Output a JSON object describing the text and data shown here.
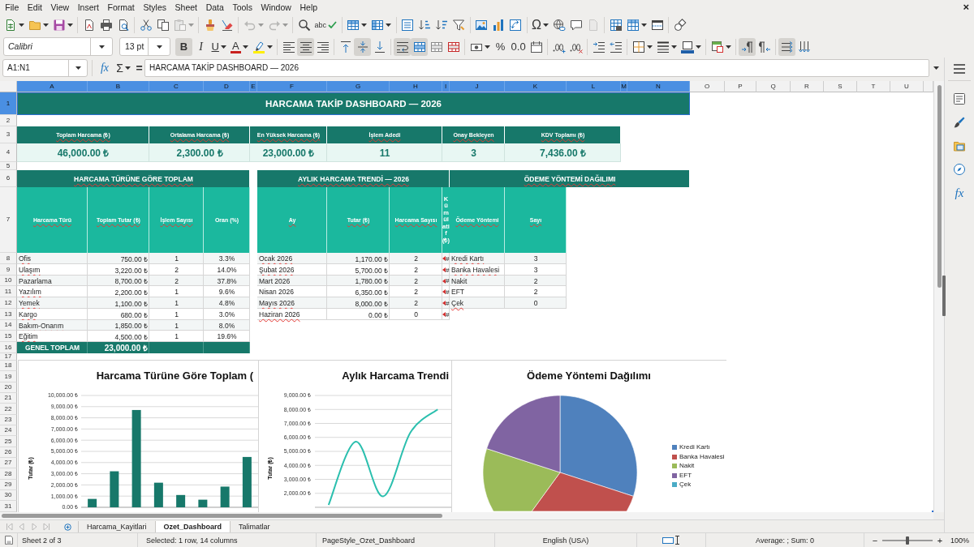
{
  "menu_bar": {
    "items": [
      "File",
      "Edit",
      "View",
      "Insert",
      "Format",
      "Styles",
      "Sheet",
      "Data",
      "Tools",
      "Window",
      "Help"
    ],
    "close": "×"
  },
  "standard_toolbar": {
    "spelling": "abc",
    "special_character": "Ω",
    "disabled": {
      "paste": true,
      "undo": true,
      "redo": true,
      "header_footer": true
    }
  },
  "formatting_toolbar": {
    "font_name": "Calibri",
    "font_size": "13 pt",
    "bold": {
      "glyph": "B",
      "pressed": true
    },
    "italic": {
      "glyph": "I",
      "pressed": false
    },
    "underline": {
      "glyph": "U",
      "pressed": false
    },
    "font_color_glyph": "A",
    "horizontal_align": {
      "left": false,
      "center": true,
      "right": false
    },
    "vertical_align": {
      "top": false,
      "middle": true,
      "bottom": false
    },
    "wrap_text": true,
    "merge_and_center": true,
    "percent": "%",
    "standard_format": "0.0",
    "paragraph_direction": {
      "left_to_right": true,
      "right_to_left": false
    },
    "text_direction": {
      "horizontal": true,
      "vertical": false
    }
  },
  "formula_bar": {
    "name_box": "A1:N1",
    "function_wizard": "fx",
    "sum": "Σ",
    "equals": "=",
    "content": "HARCAMA TAKİP DASHBOARD — 2026"
  },
  "sheet": {
    "columns": [
      {
        "label": "A",
        "selected": true
      },
      {
        "label": "B",
        "selected": true
      },
      {
        "label": "C",
        "selected": true
      },
      {
        "label": "D",
        "selected": true
      },
      {
        "label": "E",
        "selected": true
      },
      {
        "label": "F",
        "selected": true
      },
      {
        "label": "G",
        "selected": true
      },
      {
        "label": "H",
        "selected": true
      },
      {
        "label": "I",
        "selected": true
      },
      {
        "label": "J",
        "selected": true
      },
      {
        "label": "K",
        "selected": true
      },
      {
        "label": "L",
        "selected": true
      },
      {
        "label": "M",
        "selected": true
      },
      {
        "label": "N",
        "selected": true
      },
      {
        "label": "O",
        "selected": false
      },
      {
        "label": "P",
        "selected": false
      },
      {
        "label": "Q",
        "selected": false
      },
      {
        "label": "R",
        "selected": false
      },
      {
        "label": "S",
        "selected": false
      },
      {
        "label": "T",
        "selected": false
      },
      {
        "label": "U",
        "selected": false
      }
    ],
    "rows": [
      {
        "label": "1",
        "selected": true
      },
      {
        "label": "2",
        "selected": false
      },
      {
        "label": "3",
        "selected": false
      },
      {
        "label": "4",
        "selected": false
      },
      {
        "label": "5",
        "selected": false
      },
      {
        "label": "6",
        "selected": false
      },
      {
        "label": "7",
        "selected": false
      },
      {
        "label": "8",
        "selected": false
      },
      {
        "label": "9",
        "selected": false
      },
      {
        "label": "10",
        "selected": false
      },
      {
        "label": "11",
        "selected": false
      },
      {
        "label": "12",
        "selected": false
      },
      {
        "label": "13",
        "selected": false
      },
      {
        "label": "14",
        "selected": false
      },
      {
        "label": "15",
        "selected": false
      },
      {
        "label": "16",
        "selected": false
      },
      {
        "label": "17",
        "selected": false
      },
      {
        "label": "18",
        "selected": false
      },
      {
        "label": "19",
        "selected": false
      },
      {
        "label": "20",
        "selected": false
      },
      {
        "label": "21",
        "selected": false
      },
      {
        "label": "22",
        "selected": false
      },
      {
        "label": "23",
        "selected": false
      },
      {
        "label": "24",
        "selected": false
      },
      {
        "label": "25",
        "selected": false
      },
      {
        "label": "26",
        "selected": false
      },
      {
        "label": "27",
        "selected": false
      },
      {
        "label": "28",
        "selected": false
      },
      {
        "label": "29",
        "selected": false
      },
      {
        "label": "30",
        "selected": false
      },
      {
        "label": "31",
        "selected": false
      }
    ],
    "title": {
      "text": "HARCAMA TAKİP DASHBOARD — 2026",
      "selected": true
    },
    "kpis": [
      {
        "label": "Toplam Harcama (₺)",
        "flagged": true,
        "value": "46,000.00 ₺"
      },
      {
        "label": "Ortalama Harcama (₺)",
        "flagged": true,
        "value": "2,300.00 ₺"
      },
      {
        "label": "En Yüksek Harcama (₺)",
        "flagged": true,
        "value": "23,000.00 ₺"
      },
      {
        "label": "İşlem Adedi",
        "flagged": true,
        "value": "11"
      },
      {
        "label": "Onay Bekleyen",
        "flagged": true,
        "value": "3"
      },
      {
        "label": "KDV Toplamı (₺)",
        "flagged": true,
        "value": "7,436.00 ₺"
      }
    ],
    "type_table": {
      "heading": "HARCAMA TÜRÜNE GÖRE TOPLAM",
      "flagged": true,
      "columns": [
        {
          "label": "Harcama Türü",
          "flagged": true
        },
        {
          "label": "Toplam Tutar (₺)",
          "flagged": true
        },
        {
          "label": "İşlem Sayısı",
          "flagged": true
        },
        {
          "label": "Oran (%)",
          "flagged": false
        }
      ],
      "rows": [
        {
          "label": "Ofis",
          "flagged": true,
          "values": [
            "750.00 ₺",
            "1",
            "3.3%"
          ]
        },
        {
          "label": "Ulaşım",
          "flagged": true,
          "values": [
            "3,220.00 ₺",
            "2",
            "14.0%"
          ]
        },
        {
          "label": "Pazarlama",
          "flagged": true,
          "values": [
            "8,700.00 ₺",
            "2",
            "37.8%"
          ]
        },
        {
          "label": "Yazılım",
          "flagged": true,
          "values": [
            "2,200.00 ₺",
            "1",
            "9.6%"
          ]
        },
        {
          "label": "Yemek",
          "flagged": true,
          "values": [
            "1,100.00 ₺",
            "1",
            "4.8%"
          ]
        },
        {
          "label": "Kargo",
          "flagged": true,
          "values": [
            "680.00 ₺",
            "1",
            "3.0%"
          ]
        },
        {
          "label": "Bakım-Onarım",
          "flagged": true,
          "values": [
            "1,850.00 ₺",
            "1",
            "8.0%"
          ]
        },
        {
          "label": "Eğitim",
          "flagged": true,
          "values": [
            "4,500.00 ₺",
            "1",
            "19.6%"
          ]
        }
      ],
      "total": {
        "label": "GENEL TOPLAM",
        "value": "23,000.00 ₺"
      }
    },
    "monthly_table": {
      "heading": "AYLIK HARCAMA TRENDİ — 2026",
      "flagged": true,
      "columns": [
        {
          "label": "Ay",
          "flagged": true
        },
        {
          "label": "Tutar (₺)",
          "flagged": true
        },
        {
          "label": "Harcama Sayısı",
          "flagged": true
        },
        {
          "label": "Kümülatif (₺)",
          "flagged": false
        }
      ],
      "rows": [
        {
          "label": "Ocak 2026",
          "flagged": true,
          "values": [
            "1,170.00 ₺",
            "2"
          ],
          "cumulative": "#",
          "overflow": true
        },
        {
          "label": "Şubat 2026",
          "flagged": true,
          "values": [
            "5,700.00 ₺",
            "2"
          ],
          "cumulative": "#",
          "overflow": true
        },
        {
          "label": "Mart 2026",
          "flagged": false,
          "values": [
            "1,780.00 ₺",
            "2"
          ],
          "cumulative": "#",
          "overflow": true
        },
        {
          "label": "Nisan 2026",
          "flagged": false,
          "values": [
            "6,350.00 ₺",
            "2"
          ],
          "cumulative": "#",
          "overflow": true
        },
        {
          "label": "Mayıs 2026",
          "flagged": true,
          "values": [
            "8,000.00 ₺",
            "2"
          ],
          "cumulative": "#",
          "overflow": true
        },
        {
          "label": "Haziran 2026",
          "flagged": true,
          "values": [
            "0.00 ₺",
            "0"
          ],
          "cumulative": "#",
          "overflow": true
        }
      ]
    },
    "payment_table": {
      "heading": "ÖDEME YÖNTEMİ DAĞILIMI",
      "flagged": true,
      "columns": [
        {
          "label": "Ödeme Yöntemi",
          "flagged": true
        },
        {
          "label": "Sayı",
          "flagged": true
        }
      ],
      "rows": [
        {
          "label": "Kredi Kartı",
          "flagged": true,
          "values": [
            "3"
          ]
        },
        {
          "label": "Banka Havalesi",
          "flagged": true,
          "values": [
            "3"
          ]
        },
        {
          "label": "Nakit",
          "flagged": true,
          "values": [
            "2"
          ]
        },
        {
          "label": "EFT",
          "flagged": false,
          "values": [
            "2"
          ]
        },
        {
          "label": "Çek",
          "flagged": true,
          "values": [
            "0"
          ]
        }
      ]
    },
    "charts": [
      {
        "chart_data": {
          "type": "bar",
          "title": "Harcama Türüne Göre Toplam (",
          "ylabel": "Tutar (₺)",
          "grid": true,
          "series": [
            {
              "color": "#17786a",
              "values": [
                750,
                3220,
                8700,
                2200,
                1100,
                680,
                1850,
                4500
              ]
            }
          ],
          "ylim": [
            0,
            10000
          ],
          "yticks": [
            {
              "value": 0,
              "label": "0.00 ₺"
            },
            {
              "value": 1000,
              "label": "1,000.00 ₺"
            },
            {
              "value": 2000,
              "label": "2,000.00 ₺"
            },
            {
              "value": 3000,
              "label": "3,000.00 ₺"
            },
            {
              "value": 4000,
              "label": "4,000.00 ₺"
            },
            {
              "value": 5000,
              "label": "5,000.00 ₺"
            },
            {
              "value": 6000,
              "label": "6,000.00 ₺"
            },
            {
              "value": 7000,
              "label": "7,000.00 ₺"
            },
            {
              "value": 8000,
              "label": "8,000.00 ₺"
            },
            {
              "value": 9000,
              "label": "9,000.00 ₺"
            },
            {
              "value": 10000,
              "label": "10,000.00 ₺"
            }
          ]
        }
      },
      {
        "chart_data": {
          "type": "line",
          "title": "Aylık Harcama Trendi",
          "ylabel": "Tutar (₺)",
          "grid": true,
          "series": [
            {
              "color": "#2bbfae",
              "values": [
                1170,
                5700,
                1780,
                6350,
                8000
              ]
            }
          ],
          "ylim": [
            1000,
            9000
          ],
          "yticks": [
            {
              "value": 2000,
              "label": "2,000.00 ₺"
            },
            {
              "value": 3000,
              "label": "3,000.00 ₺"
            },
            {
              "value": 4000,
              "label": "4,000.00 ₺"
            },
            {
              "value": 5000,
              "label": "5,000.00 ₺"
            },
            {
              "value": 6000,
              "label": "6,000.00 ₺"
            },
            {
              "value": 7000,
              "label": "7,000.00 ₺"
            },
            {
              "value": 8000,
              "label": "8,000.00 ₺"
            },
            {
              "value": 9000,
              "label": "9,000.00 ₺"
            }
          ]
        }
      },
      {
        "chart_data": {
          "type": "pie",
          "title": "Ödeme Yöntemi Dağılımı",
          "categories": [
            "Kredi Kartı",
            "Banka Havalesi",
            "Nakit",
            "EFT",
            "Çek"
          ],
          "values": [
            30,
            30,
            20,
            20,
            0
          ],
          "colors": [
            "#4f81bd",
            "#c0504d",
            "#9bbb59",
            "#8064a2",
            "#4bacc6"
          ],
          "legend": "right"
        }
      }
    ]
  },
  "sidebar": {
    "functions": "fx"
  },
  "sheet_tabs": {
    "navigation_disabled": true,
    "tabs": [
      {
        "label": "Harcama_Kayitlari",
        "selected": false
      },
      {
        "label": "Ozet_Dashboard",
        "selected": true
      },
      {
        "label": "Talimatlar",
        "selected": false
      }
    ]
  },
  "status_bar": {
    "sheet_position": "Sheet 2 of 3",
    "selection": "Selected: 1 row, 14 columns",
    "page_style": "PageStyle_Ozet_Dashboard",
    "language": "English (USA)",
    "summary": "Average: ; Sum: 0",
    "zoom": {
      "minus": "−",
      "plus": "+",
      "level": 0.5,
      "percent": "100%"
    }
  }
}
